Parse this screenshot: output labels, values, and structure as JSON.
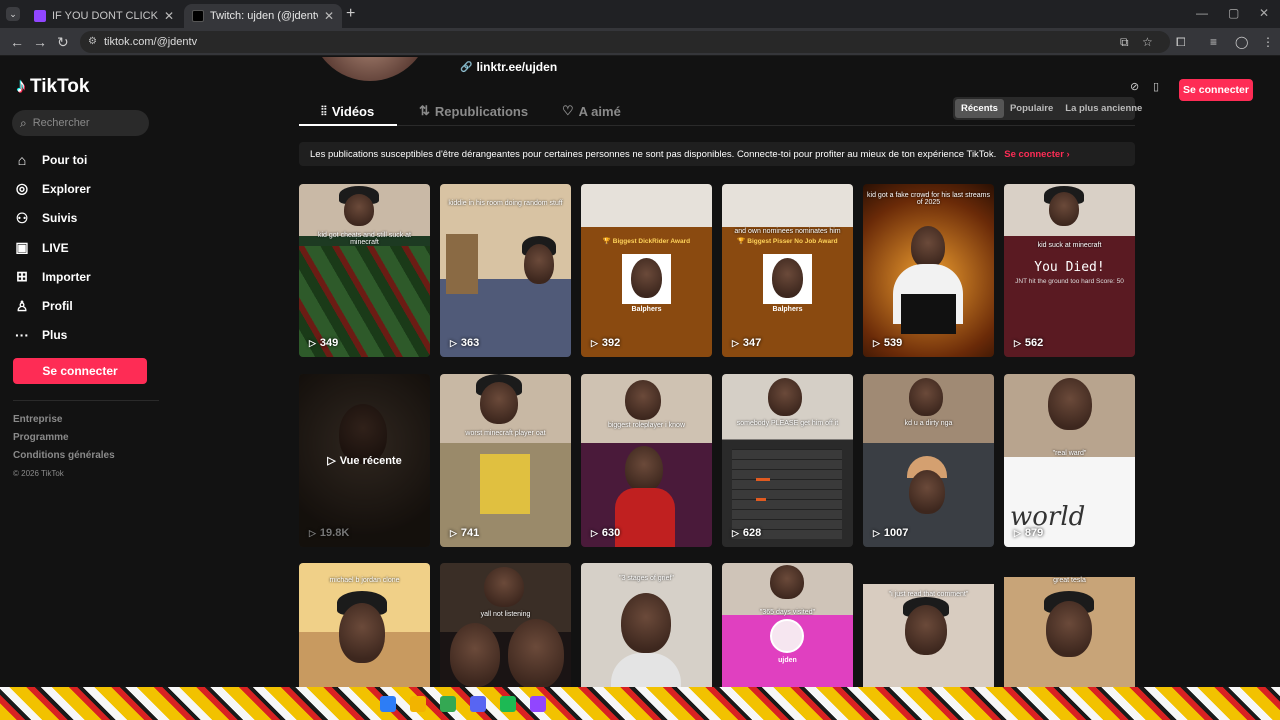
{
  "browser": {
    "tabs": [
      {
        "title": "IF YOU DONT CLICK YOU A PO",
        "close": "✕"
      },
      {
        "title": "Twitch: ujden (@jdentv) | TikTok",
        "close": "✕"
      }
    ],
    "new_tab": "+",
    "url": "tiktok.com/@jdentv"
  },
  "sidebar": {
    "logo": "TikTok",
    "search_placeholder": "Rechercher",
    "items": [
      {
        "label": "Pour toi",
        "icon": "home-icon"
      },
      {
        "label": "Explorer",
        "icon": "compass-icon"
      },
      {
        "label": "Suivis",
        "icon": "user-follow-icon"
      },
      {
        "label": "LIVE",
        "icon": "live-icon"
      },
      {
        "label": "Importer",
        "icon": "upload-icon"
      },
      {
        "label": "Profil",
        "icon": "profile-icon"
      },
      {
        "label": "Plus",
        "icon": "more-icon"
      }
    ],
    "login": "Se connecter",
    "footer": {
      "links": [
        "Entreprise",
        "Programme",
        "Conditions générales"
      ],
      "copyright": "© 2026 TikTok"
    }
  },
  "profile": {
    "link": "linktr.ee/ujden",
    "tabs": [
      {
        "label": "Vidéos",
        "icon": "grid-icon"
      },
      {
        "label": "Republications",
        "icon": "repost-icon"
      },
      {
        "label": "A aimé",
        "icon": "heart-hidden-icon"
      }
    ],
    "sort": [
      "Récents",
      "Populaire",
      "La plus ancienne"
    ],
    "header_login": "Se connecter",
    "notice": "Les publications susceptibles d'être dérangeantes pour certaines personnes ne sont pas disponibles. Connecte-toi pour profiter au mieux de ton expérience TikTok.",
    "notice_link": "Se connecter ›"
  },
  "videos": [
    {
      "caption": "kid got cheats and still suck at minecraft",
      "views": "349"
    },
    {
      "caption": "kiddie in his room doing random stuff",
      "views": "363"
    },
    {
      "caption": "",
      "award": "🏆 Biggest DickRider Award",
      "name": "Balphers",
      "views": "392"
    },
    {
      "caption": "and own nominees nominates him",
      "award": "🏆 Biggest Pisser No Job Award",
      "name": "Balphers",
      "views": "347"
    },
    {
      "caption": "kid got a fake crowd for his last streams of 2025",
      "views": "539"
    },
    {
      "caption": "kid suck at minecraft",
      "big": "You Died!",
      "sub": "JNT hit the ground too hard Score: 50",
      "views": "562"
    },
    {
      "caption": "",
      "overlay": "Vue récente",
      "views": "19.8K"
    },
    {
      "caption": "worst minecraft player oat",
      "views": "741"
    },
    {
      "caption": "biggest roleplayer i know",
      "views": "630"
    },
    {
      "caption": "somebody PLEASE get him off it",
      "views": "628"
    },
    {
      "caption": "kd u a dirty nga",
      "views": "1007"
    },
    {
      "caption": "\"real ward\"",
      "views": "879"
    },
    {
      "caption": "michael b jordan clone",
      "views": ""
    },
    {
      "caption": "yall not listening",
      "views": ""
    },
    {
      "caption": "\"3 stages of grief\"",
      "views": ""
    },
    {
      "caption": "\"365 days visited\"",
      "name": "ujden",
      "views": ""
    },
    {
      "caption": "\"i just read that comment\"",
      "views": ""
    },
    {
      "caption": "great tesla",
      "views": ""
    }
  ],
  "colors": {
    "accent": "#fe2c55",
    "bg": "#121212"
  }
}
